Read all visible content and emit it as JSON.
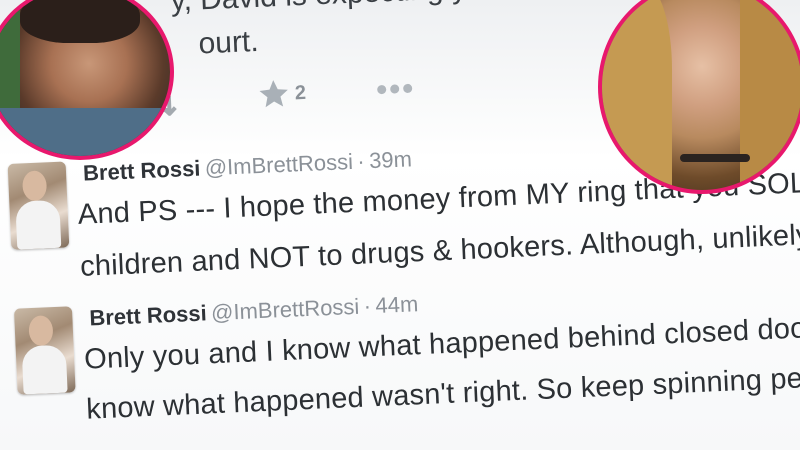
{
  "top_tweet": {
    "line1": "y, David is expecting your call...",
    "line2": "ourt.",
    "favorite_count": "2"
  },
  "tweets": [
    {
      "name": "Brett Rossi",
      "handle": "@ImBrettRossi",
      "separator": "·",
      "time": "39m",
      "line1": "And PS --- I hope the money from MY ring that you SOLD w",
      "line2": "children and NOT to drugs & hookers. Although, unlikely."
    },
    {
      "name": "Brett Rossi",
      "handle": "@ImBrettRossi",
      "separator": "·",
      "time": "44m",
      "line1": "Only you and I know what happened behind closed doors",
      "line2": "know what happened wasn't right. So keep spinning peo"
    }
  ],
  "colors": {
    "portrait_border": "#e8186d",
    "muted_text": "#8b9198",
    "body_text": "#2c3034"
  },
  "icons": [
    "retweet-icon",
    "star-icon",
    "more-dots-icon"
  ]
}
